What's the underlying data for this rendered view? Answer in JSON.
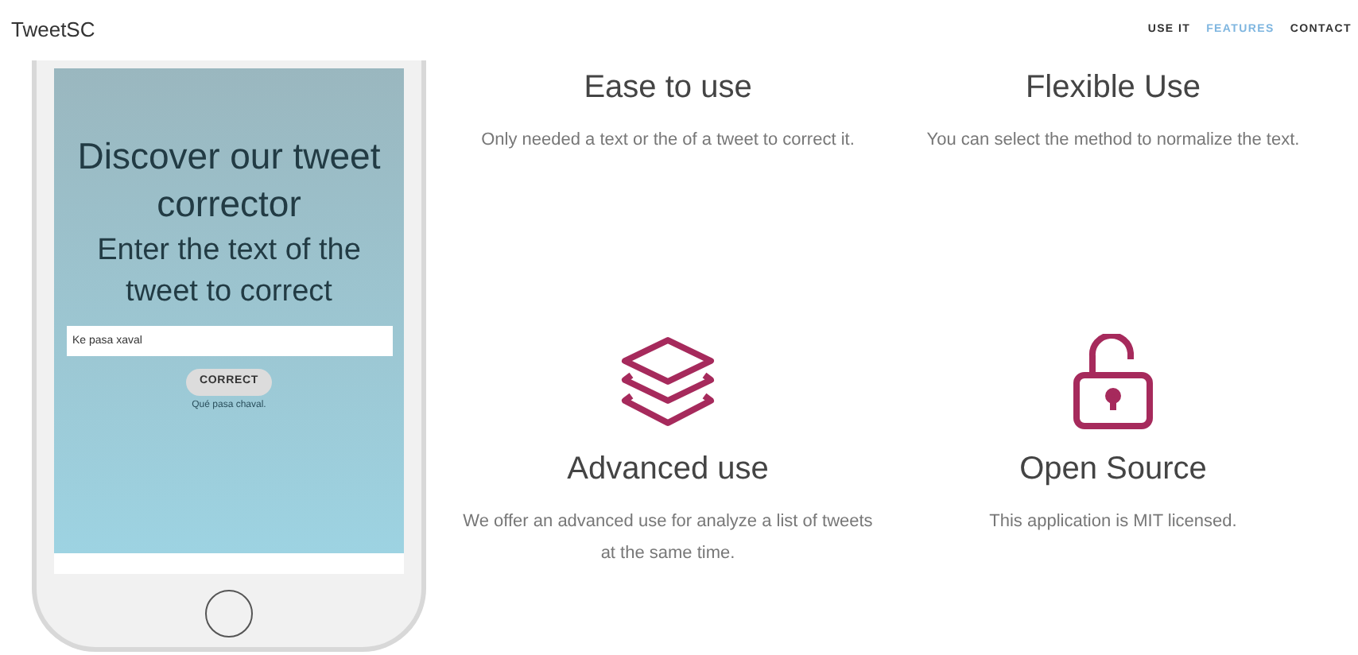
{
  "brand": "TweetSC",
  "nav": [
    {
      "label": "USE IT",
      "selected": false
    },
    {
      "label": "FEATURES",
      "selected": true
    },
    {
      "label": "CONTACT",
      "selected": false
    }
  ],
  "phone": {
    "heading": "Discover our tweet corrector",
    "subheading": "Enter the text of the tweet to correct",
    "input_value": "Ke pasa xaval",
    "button": "CORRECT",
    "result": "Qué pasa chaval."
  },
  "features": [
    {
      "kind": "text",
      "title": "Ease to use",
      "description": "Only needed a text or the of a tweet to correct it."
    },
    {
      "kind": "text",
      "title": "Flexible Use",
      "description": "You can select the method to normalize the text."
    },
    {
      "kind": "icon",
      "title": "Advanced use",
      "description": "We offer an advanced use for analyze a list of tweets at the same time."
    },
    {
      "kind": "icon",
      "title": "Open Source",
      "description": "This application is MIT licensed."
    }
  ]
}
